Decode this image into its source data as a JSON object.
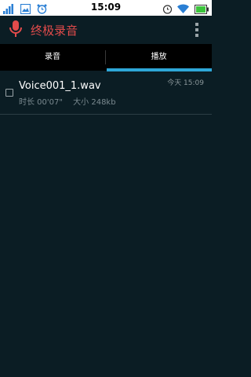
{
  "status_bar": {
    "time": "15:09",
    "icons": [
      "signal-icon",
      "gallery-icon",
      "alarm-clock-icon",
      "alarm-icon",
      "wifi-icon",
      "battery-icon"
    ]
  },
  "app": {
    "title": "终极录音",
    "accent_color": "#e24b4b",
    "icons": [
      "microphone-icon",
      "overflow-menu-icon"
    ]
  },
  "tabs": [
    {
      "label": "录音",
      "selected": false
    },
    {
      "label": "播放",
      "selected": true
    }
  ],
  "tab_indicator_color": "#2ea7d8",
  "recordings": [
    {
      "filename": "Voice001_1.wav",
      "duration": "时长 00'07\"",
      "size": "大小 248kb",
      "date": "今天 15:09",
      "checked": false
    }
  ]
}
